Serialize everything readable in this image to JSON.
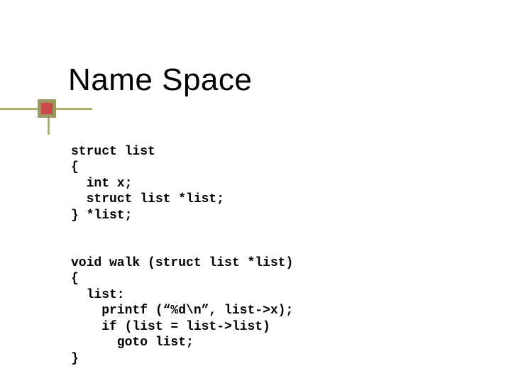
{
  "title": "Name Space",
  "code": {
    "l01": "struct list",
    "l02": "{",
    "l03": "  int x;",
    "l04": "  struct list *list;",
    "l05": "} *list;",
    "l06": "void walk (struct list *list)",
    "l07": "{",
    "l08": "  list:",
    "l09": "    printf (“%d\\n”, list->x);",
    "l10": "    if (list = list->list)",
    "l11": "      goto list;",
    "l12": "}"
  }
}
